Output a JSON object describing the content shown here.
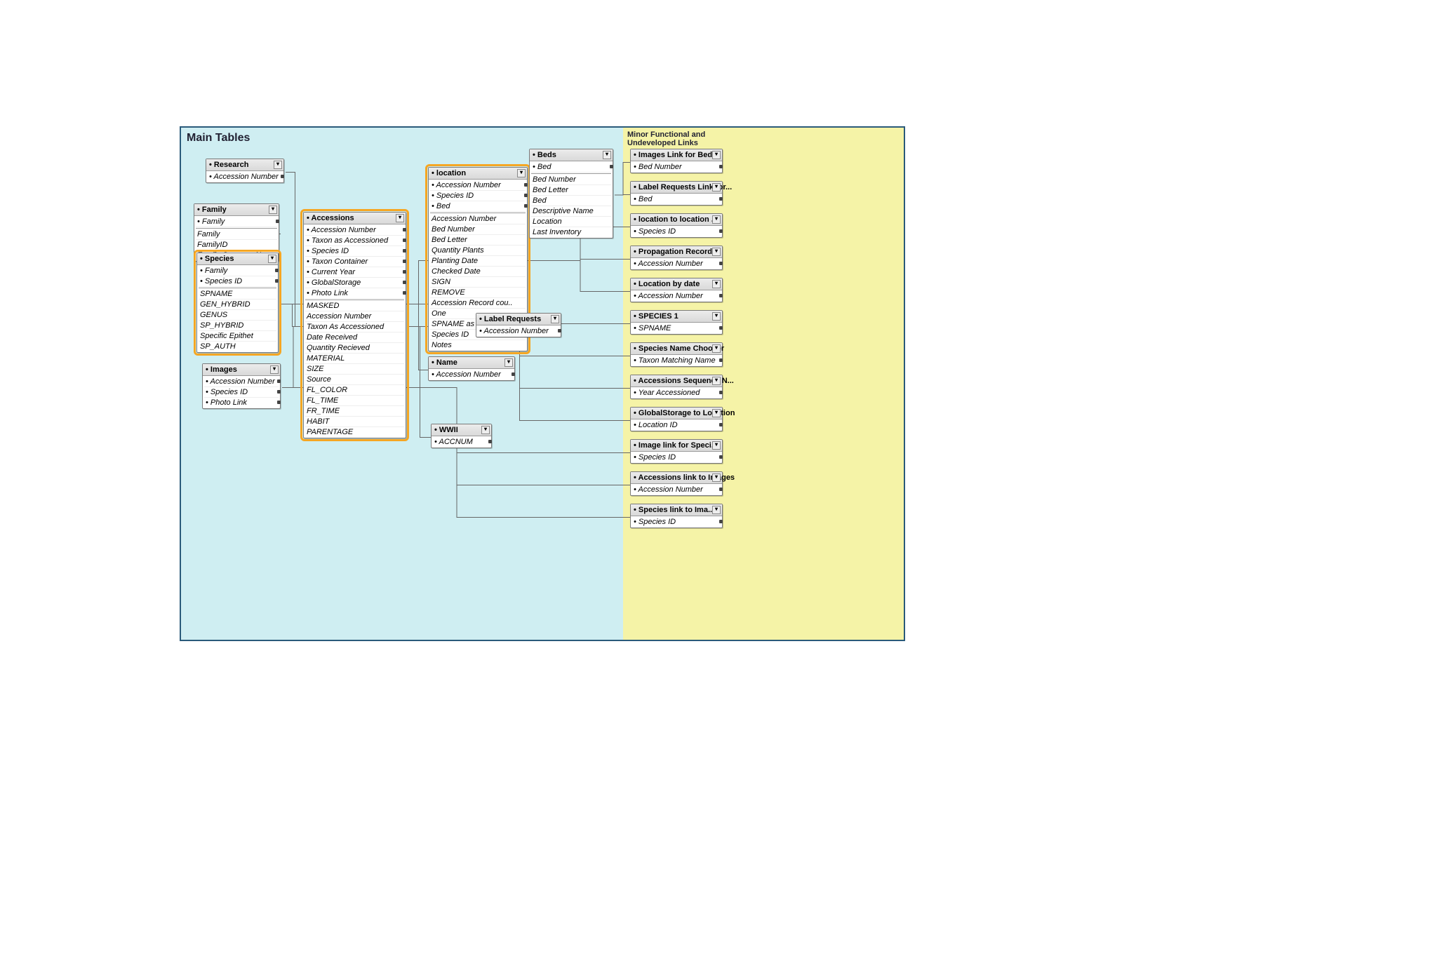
{
  "section_main_title": "Main Tables",
  "section_side_title": "Minor Functional and Undeveloped Links",
  "tables": {
    "research": {
      "title": "Research",
      "fields": [
        "Accession Number"
      ]
    },
    "family": {
      "title": "Family",
      "fields": [
        "Family"
      ],
      "extra": [
        "Family",
        "FamilyID",
        "Family Common Name"
      ]
    },
    "species": {
      "title": "Species",
      "fields": [
        "Family",
        "Species ID"
      ],
      "extra": [
        "SPNAME",
        "GEN_HYBRID",
        "GENUS",
        "SP_HYBRID",
        "Specific Epithet",
        "SP_AUTH"
      ]
    },
    "images": {
      "title": "Images",
      "fields": [
        "Accession Number",
        "Species ID",
        "Photo Link"
      ]
    },
    "accessions": {
      "title": "Accessions",
      "fields": [
        "Accession Number",
        "Taxon as Accessioned",
        "Species ID",
        "Taxon Container",
        "Current Year",
        "GlobalStorage",
        "Photo Link"
      ],
      "extra": [
        "MASKED",
        "Accession Number",
        "Taxon As Accessioned",
        "Date Received",
        "Quantity Recieved",
        "MATERIAL",
        "SIZE",
        "Source",
        "FL_COLOR",
        "FL_TIME",
        "FR_TIME",
        "HABIT",
        "PARENTAGE"
      ]
    },
    "location": {
      "title": "location",
      "fields": [
        "Accession Number",
        "Species ID",
        "Bed"
      ],
      "extra": [
        "Accession Number",
        "Bed Number",
        "Bed Letter",
        "Quantity Plants",
        "Planting Date",
        "Checked Date",
        "SIGN",
        "REMOVE",
        "Accession Record cou..",
        "One",
        "SPNAME as accession..",
        "Species ID",
        "Notes"
      ]
    },
    "beds": {
      "title": "Beds",
      "fields": [
        "Bed"
      ],
      "extra": [
        "Bed Number",
        "Bed Letter",
        "Bed",
        "Descriptive Name",
        "Location",
        "Last Inventory"
      ]
    },
    "name": {
      "title": "Name",
      "fields": [
        "Accession Number"
      ]
    },
    "wwii": {
      "title": "WWII",
      "fields": [
        "ACCNUM"
      ]
    },
    "labelreq": {
      "title": "Label Requests",
      "fields": [
        "Accession Number"
      ]
    }
  },
  "side_tables": [
    {
      "title": "Images Link for Beds",
      "field": "Bed Number"
    },
    {
      "title": "Label Requests Link for...",
      "field": "Bed"
    },
    {
      "title": "location to location ...",
      "field": "Species ID"
    },
    {
      "title": "Propagation Records",
      "field": "Accession Number"
    },
    {
      "title": "Location by date",
      "field": "Accession Number"
    },
    {
      "title": "SPECIES 1",
      "field": "SPNAME"
    },
    {
      "title": "Species Name Chooser",
      "field": "Taxon Matching Name"
    },
    {
      "title": "Accessions Sequence N...",
      "field": "Year Accessioned"
    },
    {
      "title": "GlobalStorage to Location",
      "field": "Location ID"
    },
    {
      "title": "Image link for Speci...",
      "field": "Species ID"
    },
    {
      "title": "Accessions link to Images",
      "field": "Accession Number"
    },
    {
      "title": "Species link to Ima...",
      "field": "Species ID"
    }
  ],
  "connections": [
    {
      "from": "research",
      "to": "accessions"
    },
    {
      "from": "family",
      "to": "species"
    },
    {
      "from": "species",
      "to": "accessions"
    },
    {
      "from": "images",
      "to": "accessions"
    },
    {
      "from": "accessions",
      "to": "location"
    },
    {
      "from": "accessions",
      "to": "name"
    },
    {
      "from": "accessions",
      "to": "wwii"
    },
    {
      "from": "location",
      "to": "beds"
    },
    {
      "from": "location",
      "to": "labelreq"
    },
    {
      "from": "beds",
      "to": "side:0"
    },
    {
      "from": "beds",
      "to": "side:1"
    },
    {
      "from": "location",
      "to": "side:2"
    },
    {
      "from": "location",
      "to": "side:3"
    },
    {
      "from": "location",
      "to": "side:4"
    },
    {
      "from": "species",
      "to": "side:5"
    },
    {
      "from": "accessions",
      "to": "side:6"
    },
    {
      "from": "accessions",
      "to": "side:7"
    },
    {
      "from": "accessions",
      "to": "side:8"
    },
    {
      "from": "images",
      "to": "side:9"
    },
    {
      "from": "images",
      "to": "side:10"
    },
    {
      "from": "images",
      "to": "side:11"
    }
  ]
}
